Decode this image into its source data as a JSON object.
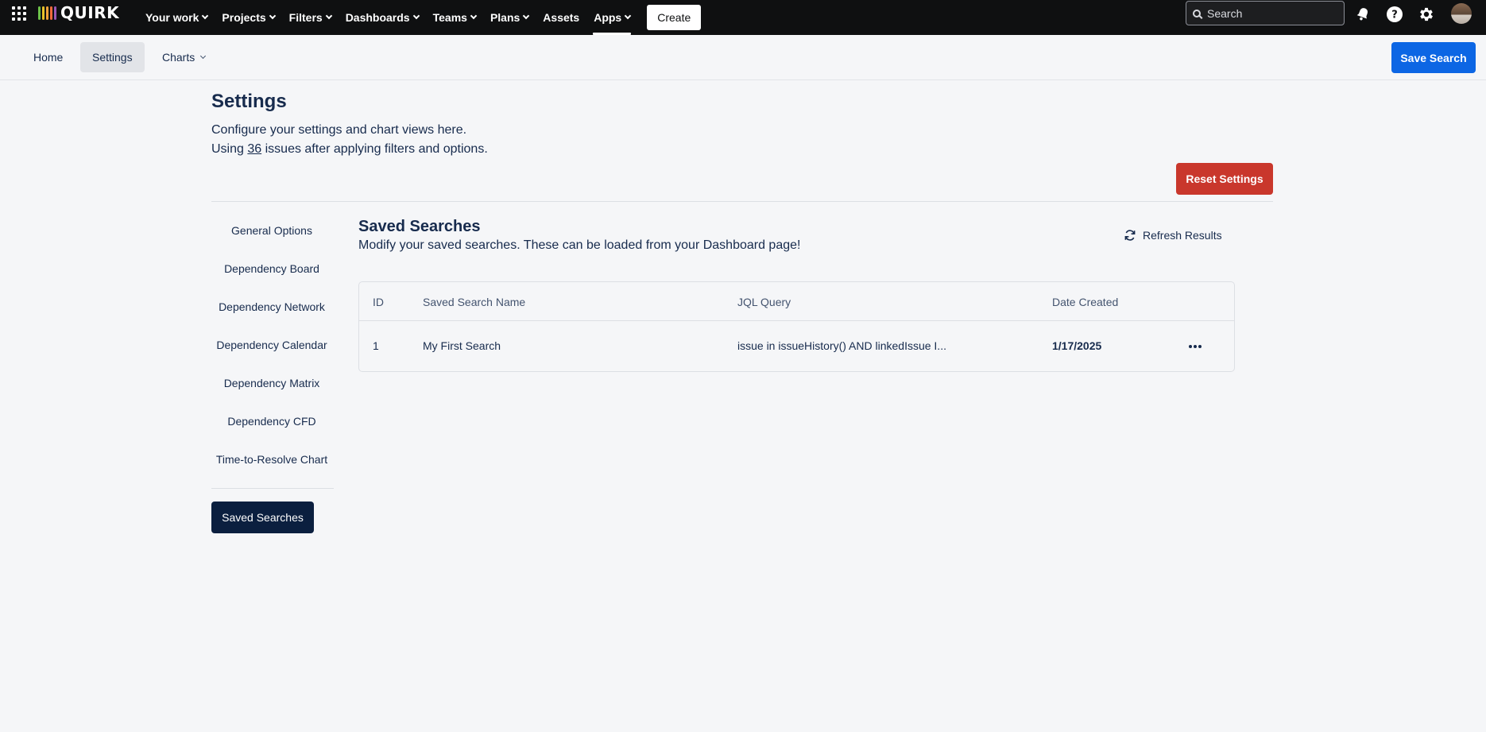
{
  "topnav": {
    "logo_text": "QUIRK",
    "logo_bar_colors": [
      "#6cc24a",
      "#e6c229",
      "#f0a43a",
      "#f06a3a",
      "#9b59b6"
    ],
    "items": [
      {
        "label": "Your work",
        "dropdown": true
      },
      {
        "label": "Projects",
        "dropdown": true
      },
      {
        "label": "Filters",
        "dropdown": true
      },
      {
        "label": "Dashboards",
        "dropdown": true
      },
      {
        "label": "Teams",
        "dropdown": true
      },
      {
        "label": "Plans",
        "dropdown": true
      },
      {
        "label": "Assets",
        "dropdown": false
      },
      {
        "label": "Apps",
        "dropdown": true,
        "active": true
      }
    ],
    "create_label": "Create",
    "search_placeholder": "Search",
    "icons": [
      "notifications-icon",
      "help-icon",
      "settings-icon"
    ]
  },
  "subnav": {
    "tabs": [
      {
        "label": "Home"
      },
      {
        "label": "Settings",
        "selected": true
      },
      {
        "label": "Charts",
        "dropdown": true
      }
    ],
    "save_search_label": "Save Search"
  },
  "header": {
    "title": "Settings",
    "description_line1": "Configure your settings and chart views here.",
    "description_prefix": "Using",
    "issue_count": "36",
    "description_suffix": "issues after applying filters and options.",
    "reset_label": "Reset Settings"
  },
  "sidebar": {
    "items": [
      {
        "label": "General Options"
      },
      {
        "label": "Dependency Board"
      },
      {
        "label": "Dependency Network"
      },
      {
        "label": "Dependency Calendar"
      },
      {
        "label": "Dependency Matrix"
      },
      {
        "label": "Dependency CFD"
      },
      {
        "label": "Time-to-Resolve Chart"
      }
    ],
    "saved_searches_label": "Saved Searches"
  },
  "saved_searches": {
    "title": "Saved Searches",
    "description": "Modify your saved searches. These can be loaded from your Dashboard page!",
    "refresh_label": "Refresh Results",
    "columns": [
      "ID",
      "Saved Search Name",
      "JQL Query",
      "Date Created"
    ],
    "rows": [
      {
        "id": "1",
        "name": "My First Search",
        "jql": "issue in issueHistory() AND linkedIssue I...",
        "date": "1/17/2025"
      }
    ]
  },
  "colors": {
    "primary": "#0c66e4",
    "danger": "#c9372c",
    "active_sidebar": "#0b1f3f",
    "topnav_bg": "#0f1011"
  }
}
